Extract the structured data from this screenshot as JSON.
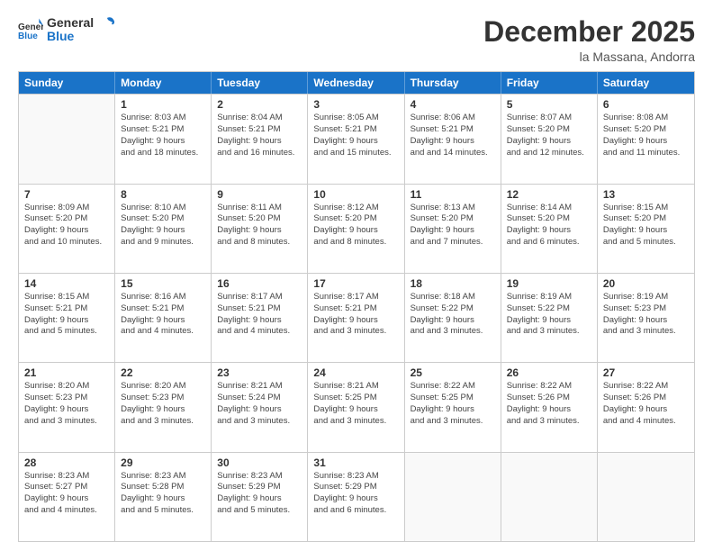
{
  "header": {
    "logo_general": "General",
    "logo_blue": "Blue",
    "month": "December 2025",
    "location": "la Massana, Andorra"
  },
  "days": [
    "Sunday",
    "Monday",
    "Tuesday",
    "Wednesday",
    "Thursday",
    "Friday",
    "Saturday"
  ],
  "weeks": [
    [
      {
        "day": "",
        "empty": true
      },
      {
        "day": "1",
        "sunrise": "8:03 AM",
        "sunset": "5:21 PM",
        "daylight": "9 hours and 18 minutes."
      },
      {
        "day": "2",
        "sunrise": "8:04 AM",
        "sunset": "5:21 PM",
        "daylight": "9 hours and 16 minutes."
      },
      {
        "day": "3",
        "sunrise": "8:05 AM",
        "sunset": "5:21 PM",
        "daylight": "9 hours and 15 minutes."
      },
      {
        "day": "4",
        "sunrise": "8:06 AM",
        "sunset": "5:21 PM",
        "daylight": "9 hours and 14 minutes."
      },
      {
        "day": "5",
        "sunrise": "8:07 AM",
        "sunset": "5:20 PM",
        "daylight": "9 hours and 12 minutes."
      },
      {
        "day": "6",
        "sunrise": "8:08 AM",
        "sunset": "5:20 PM",
        "daylight": "9 hours and 11 minutes."
      }
    ],
    [
      {
        "day": "7",
        "sunrise": "8:09 AM",
        "sunset": "5:20 PM",
        "daylight": "9 hours and 10 minutes."
      },
      {
        "day": "8",
        "sunrise": "8:10 AM",
        "sunset": "5:20 PM",
        "daylight": "9 hours and 9 minutes."
      },
      {
        "day": "9",
        "sunrise": "8:11 AM",
        "sunset": "5:20 PM",
        "daylight": "9 hours and 8 minutes."
      },
      {
        "day": "10",
        "sunrise": "8:12 AM",
        "sunset": "5:20 PM",
        "daylight": "9 hours and 8 minutes."
      },
      {
        "day": "11",
        "sunrise": "8:13 AM",
        "sunset": "5:20 PM",
        "daylight": "9 hours and 7 minutes."
      },
      {
        "day": "12",
        "sunrise": "8:14 AM",
        "sunset": "5:20 PM",
        "daylight": "9 hours and 6 minutes."
      },
      {
        "day": "13",
        "sunrise": "8:15 AM",
        "sunset": "5:20 PM",
        "daylight": "9 hours and 5 minutes."
      }
    ],
    [
      {
        "day": "14",
        "sunrise": "8:15 AM",
        "sunset": "5:21 PM",
        "daylight": "9 hours and 5 minutes."
      },
      {
        "day": "15",
        "sunrise": "8:16 AM",
        "sunset": "5:21 PM",
        "daylight": "9 hours and 4 minutes."
      },
      {
        "day": "16",
        "sunrise": "8:17 AM",
        "sunset": "5:21 PM",
        "daylight": "9 hours and 4 minutes."
      },
      {
        "day": "17",
        "sunrise": "8:17 AM",
        "sunset": "5:21 PM",
        "daylight": "9 hours and 3 minutes."
      },
      {
        "day": "18",
        "sunrise": "8:18 AM",
        "sunset": "5:22 PM",
        "daylight": "9 hours and 3 minutes."
      },
      {
        "day": "19",
        "sunrise": "8:19 AM",
        "sunset": "5:22 PM",
        "daylight": "9 hours and 3 minutes."
      },
      {
        "day": "20",
        "sunrise": "8:19 AM",
        "sunset": "5:23 PM",
        "daylight": "9 hours and 3 minutes."
      }
    ],
    [
      {
        "day": "21",
        "sunrise": "8:20 AM",
        "sunset": "5:23 PM",
        "daylight": "9 hours and 3 minutes."
      },
      {
        "day": "22",
        "sunrise": "8:20 AM",
        "sunset": "5:23 PM",
        "daylight": "9 hours and 3 minutes."
      },
      {
        "day": "23",
        "sunrise": "8:21 AM",
        "sunset": "5:24 PM",
        "daylight": "9 hours and 3 minutes."
      },
      {
        "day": "24",
        "sunrise": "8:21 AM",
        "sunset": "5:25 PM",
        "daylight": "9 hours and 3 minutes."
      },
      {
        "day": "25",
        "sunrise": "8:22 AM",
        "sunset": "5:25 PM",
        "daylight": "9 hours and 3 minutes."
      },
      {
        "day": "26",
        "sunrise": "8:22 AM",
        "sunset": "5:26 PM",
        "daylight": "9 hours and 3 minutes."
      },
      {
        "day": "27",
        "sunrise": "8:22 AM",
        "sunset": "5:26 PM",
        "daylight": "9 hours and 4 minutes."
      }
    ],
    [
      {
        "day": "28",
        "sunrise": "8:23 AM",
        "sunset": "5:27 PM",
        "daylight": "9 hours and 4 minutes."
      },
      {
        "day": "29",
        "sunrise": "8:23 AM",
        "sunset": "5:28 PM",
        "daylight": "9 hours and 5 minutes."
      },
      {
        "day": "30",
        "sunrise": "8:23 AM",
        "sunset": "5:29 PM",
        "daylight": "9 hours and 5 minutes."
      },
      {
        "day": "31",
        "sunrise": "8:23 AM",
        "sunset": "5:29 PM",
        "daylight": "9 hours and 6 minutes."
      },
      {
        "day": "",
        "empty": true
      },
      {
        "day": "",
        "empty": true
      },
      {
        "day": "",
        "empty": true
      }
    ]
  ]
}
